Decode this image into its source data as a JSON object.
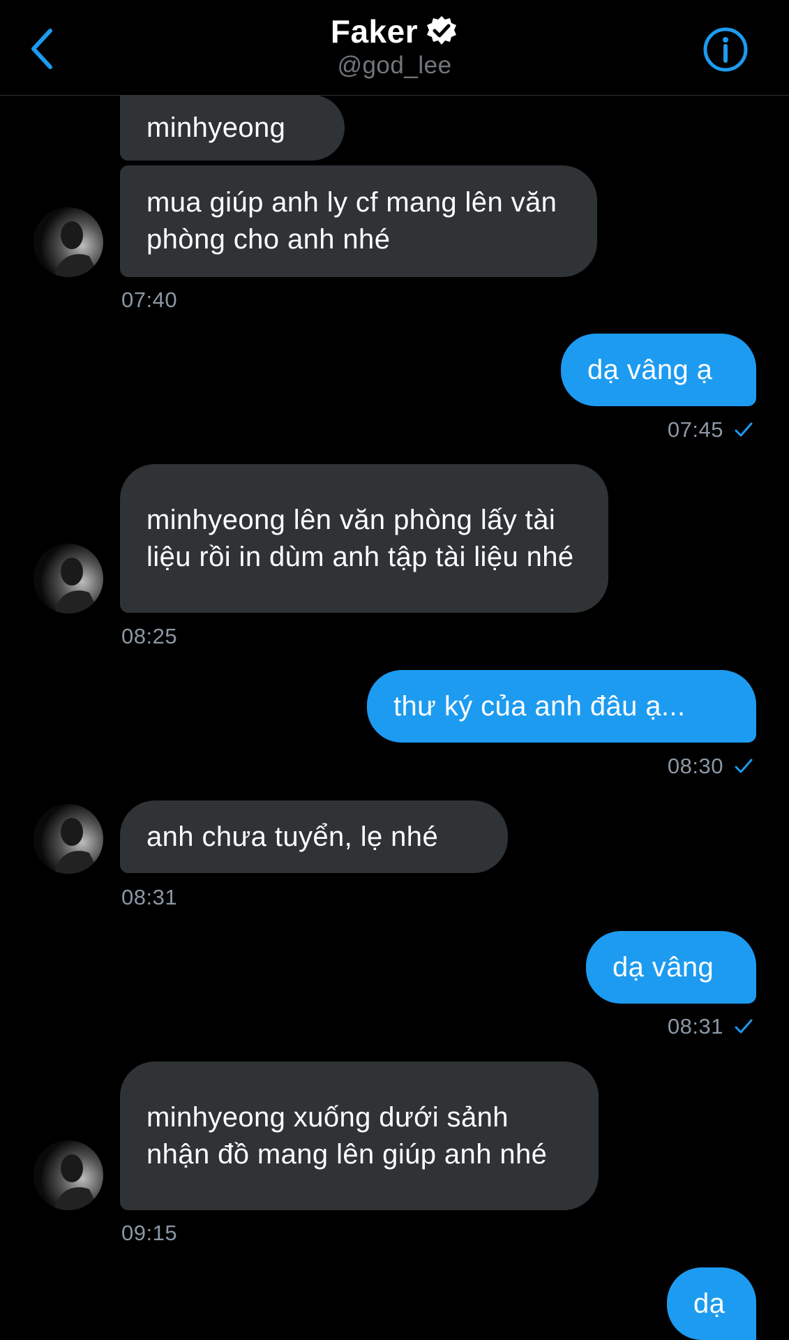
{
  "header": {
    "name": "Faker",
    "handle": "@god_lee"
  },
  "messages": [
    {
      "text": "minhyeong"
    },
    {
      "text": "mua giúp anh ly cf mang lên văn phòng cho anh nhé",
      "time": "07:40"
    },
    {
      "text": "dạ vâng ạ",
      "time": "07:45"
    },
    {
      "text": "minhyeong lên văn phòng lấy tài liệu rồi in dùm anh tập tài liệu nhé",
      "time": "08:25"
    },
    {
      "text": "thư ký của anh đâu ạ...",
      "time": "08:30"
    },
    {
      "text": "anh chưa tuyển, lẹ nhé",
      "time": "08:31"
    },
    {
      "text": "dạ vâng",
      "time": "08:31"
    },
    {
      "text": "minhyeong xuống dưới sảnh nhận đồ mang lên giúp anh nhé",
      "time": "09:15"
    },
    {
      "text": "dạ"
    }
  ],
  "theme": {
    "background": "#000000",
    "accent": "#1d9bf0",
    "incoming_bubble": "#2f3336",
    "timestamp": "#8b98a5"
  },
  "icons": {
    "back": "chevron-left-icon",
    "verified": "verified-badge-icon",
    "info": "info-circle-icon",
    "sent": "checkmark-icon"
  }
}
